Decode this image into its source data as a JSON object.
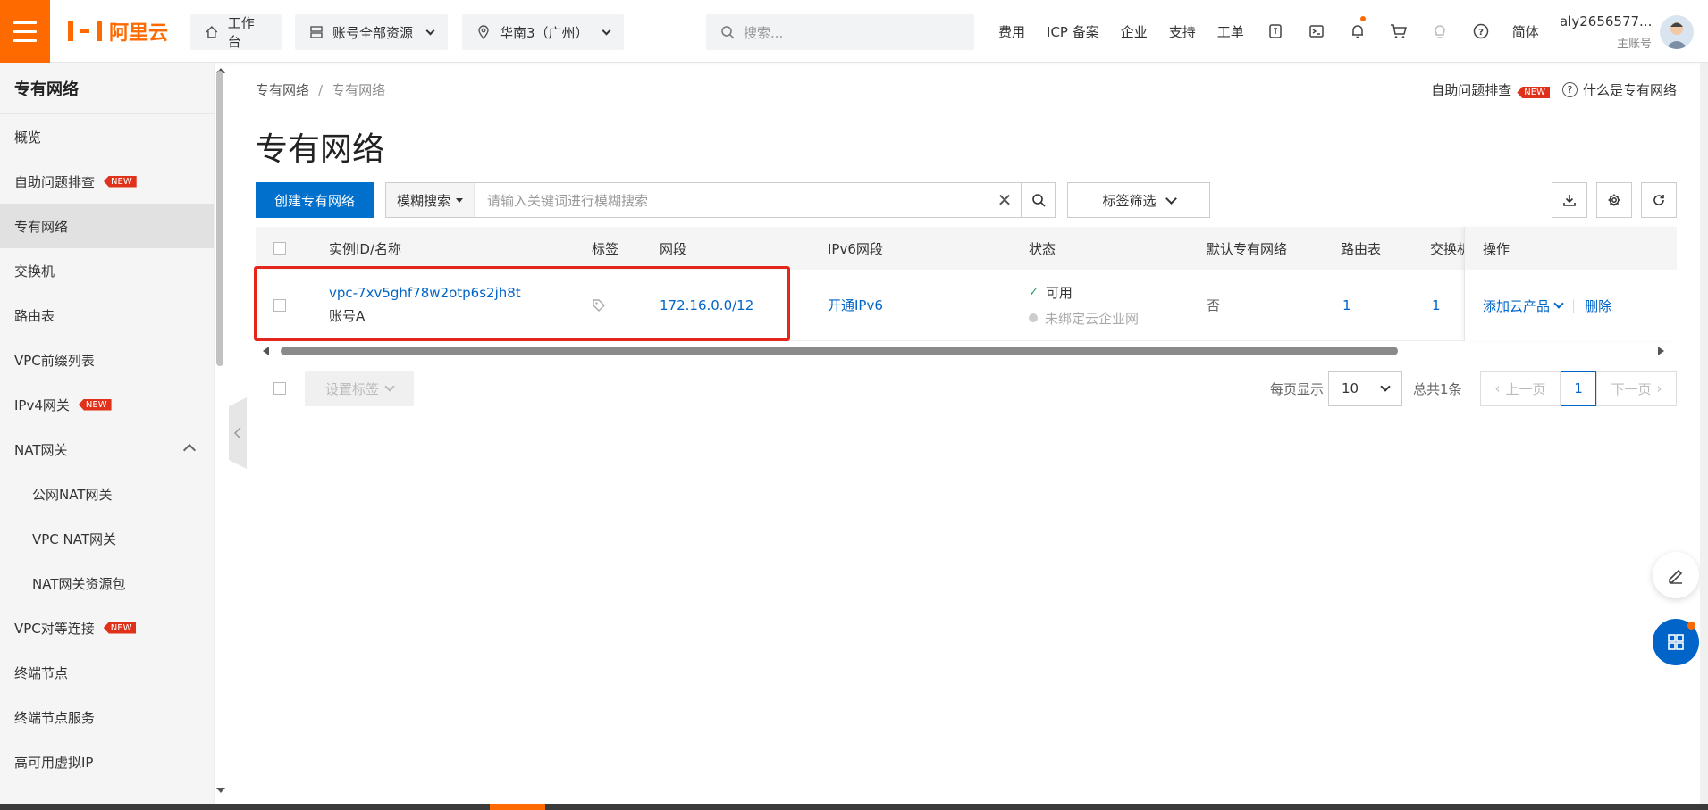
{
  "topbar": {
    "logo_text": "阿里云",
    "workbench": "工作台",
    "resources": "账号全部资源",
    "region": "华南3（广州）",
    "search_placeholder": "搜索...",
    "links": [
      "费用",
      "ICP 备案",
      "企业",
      "支持",
      "工单"
    ],
    "lang": "简体",
    "user_name": "aly2656577...",
    "user_role": "主账号"
  },
  "sidebar": {
    "title": "专有网络",
    "new_badge": "NEW",
    "items": [
      {
        "label": "概览"
      },
      {
        "label": "自助问题排查",
        "new": true
      },
      {
        "label": "专有网络",
        "active": true
      },
      {
        "label": "交换机"
      },
      {
        "label": "路由表"
      },
      {
        "label": "VPC前缀列表"
      },
      {
        "label": "IPv4网关",
        "new": true
      },
      {
        "label": "NAT网关",
        "expand": true
      },
      {
        "label": "公网NAT网关",
        "sub": true
      },
      {
        "label": "VPC NAT网关",
        "sub": true
      },
      {
        "label": "NAT网关资源包",
        "sub": true
      },
      {
        "label": "VPC对等连接",
        "new": true
      },
      {
        "label": "终端节点"
      },
      {
        "label": "终端节点服务"
      },
      {
        "label": "高可用虚拟IP"
      }
    ]
  },
  "main": {
    "breadcrumb": [
      "专有网络",
      "专有网络"
    ],
    "self_check": "自助问题排查",
    "what_is": "什么是专有网络",
    "page_title": "专有网络",
    "create_btn": "创建专有网络",
    "search_mode": "模糊搜索",
    "search_placeholder": "请输入关键词进行模糊搜索",
    "tag_filter": "标签筛选",
    "columns": [
      "实例ID/名称",
      "标签",
      "网段",
      "IPv6网段",
      "状态",
      "默认专有网络",
      "路由表",
      "交换机",
      "操作"
    ],
    "row": {
      "id": "vpc-7xv5ghf78w2otp6s2jh8t",
      "name": "账号A",
      "cidr": "172.16.0.0/12",
      "ipv6": "开通IPv6",
      "status": "可用",
      "status2": "未绑定云企业网",
      "default": "否",
      "route_tables": "1",
      "vswitches": "1",
      "op_add": "添加云产品",
      "op_delete": "删除"
    },
    "set_tags": "设置标签",
    "per_page_label": "每页显示",
    "per_page": "10",
    "total": "总共1条",
    "prev": "上一页",
    "page": "1",
    "next": "下一页"
  },
  "colors": {
    "accent": "#ff6a00",
    "primary": "#0070cc",
    "link": "#0064c8",
    "highlight": "#e5261d"
  }
}
